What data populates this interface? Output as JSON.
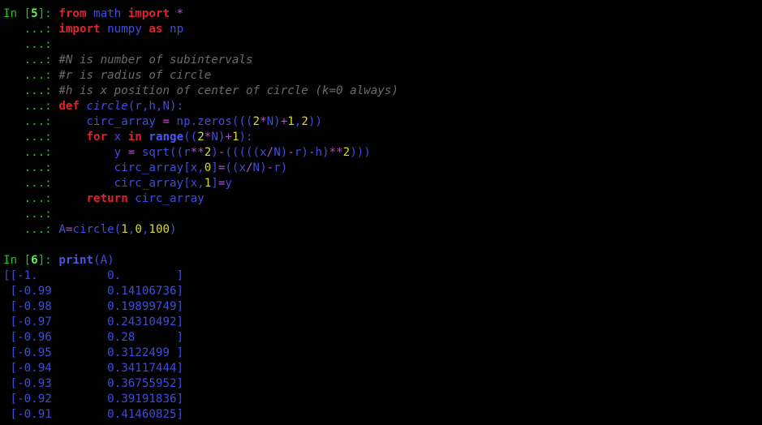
{
  "colors": {
    "background": "#000000",
    "prompt": "#22c322",
    "prompt_number": "#5cf05c",
    "keyword": "#e0222f",
    "name": "#3f4cdb",
    "number": "#d8d829",
    "operator": "#b24fd0",
    "comment": "#6a6a6a"
  },
  "lines": [
    [
      [
        "c-prompt",
        "In ["
      ],
      [
        "c-pnum",
        "5"
      ],
      [
        "c-prompt",
        "]: "
      ],
      [
        "c-kw",
        "from"
      ],
      [
        "c-name",
        " math "
      ],
      [
        "c-kw",
        "import"
      ],
      [
        "c-name",
        " "
      ],
      [
        "c-op",
        "*"
      ]
    ],
    [
      [
        "c-prompt",
        "   ...: "
      ],
      [
        "c-kw",
        "import"
      ],
      [
        "c-name",
        " numpy "
      ],
      [
        "c-kw",
        "as"
      ],
      [
        "c-name",
        " np"
      ]
    ],
    [
      [
        "c-prompt",
        "   ...: "
      ]
    ],
    [
      [
        "c-prompt",
        "   ...: "
      ],
      [
        "c-comment",
        "#N is number of subintervals"
      ]
    ],
    [
      [
        "c-prompt",
        "   ...: "
      ],
      [
        "c-comment",
        "#r is radius of circle"
      ]
    ],
    [
      [
        "c-prompt",
        "   ...: "
      ],
      [
        "c-comment",
        "#h is x position of center of circle (k=0 always)"
      ]
    ],
    [
      [
        "c-prompt",
        "   ...: "
      ],
      [
        "c-kw",
        "def"
      ],
      [
        "c-name",
        " "
      ],
      [
        "c-fn",
        "circle"
      ],
      [
        "c-name",
        "(r,h,N):"
      ]
    ],
    [
      [
        "c-prompt",
        "   ...: "
      ],
      [
        "c-name",
        "    circ_array "
      ],
      [
        "c-op",
        "="
      ],
      [
        "c-name",
        " np.zeros((("
      ],
      [
        "c-num",
        "2"
      ],
      [
        "c-op",
        "*"
      ],
      [
        "c-name",
        "N)"
      ],
      [
        "c-op",
        "+"
      ],
      [
        "c-num",
        "1"
      ],
      [
        "c-name",
        ","
      ],
      [
        "c-num",
        "2"
      ],
      [
        "c-name",
        "))"
      ]
    ],
    [
      [
        "c-prompt",
        "   ...: "
      ],
      [
        "c-name",
        "    "
      ],
      [
        "c-kw",
        "for"
      ],
      [
        "c-name",
        " x "
      ],
      [
        "c-kw",
        "in"
      ],
      [
        "c-name",
        " "
      ],
      [
        "c-builtin",
        "range"
      ],
      [
        "c-name",
        "(("
      ],
      [
        "c-num",
        "2"
      ],
      [
        "c-op",
        "*"
      ],
      [
        "c-name",
        "N)"
      ],
      [
        "c-op",
        "+"
      ],
      [
        "c-num",
        "1"
      ],
      [
        "c-name",
        "):"
      ]
    ],
    [
      [
        "c-prompt",
        "   ...: "
      ],
      [
        "c-name",
        "        y "
      ],
      [
        "c-op",
        "="
      ],
      [
        "c-name",
        " sqrt((r"
      ],
      [
        "c-op",
        "**"
      ],
      [
        "c-num",
        "2"
      ],
      [
        "c-name",
        ")"
      ],
      [
        "c-op",
        "-"
      ],
      [
        "c-name",
        "(((((x"
      ],
      [
        "c-op",
        "/"
      ],
      [
        "c-name",
        "N)"
      ],
      [
        "c-op",
        "-"
      ],
      [
        "c-name",
        "r)"
      ],
      [
        "c-op",
        "-"
      ],
      [
        "c-name",
        "h)"
      ],
      [
        "c-op",
        "**"
      ],
      [
        "c-num",
        "2"
      ],
      [
        "c-name",
        ")))"
      ]
    ],
    [
      [
        "c-prompt",
        "   ...: "
      ],
      [
        "c-name",
        "        circ_array[x,"
      ],
      [
        "c-num",
        "0"
      ],
      [
        "c-name",
        "]"
      ],
      [
        "c-op",
        "="
      ],
      [
        "c-name",
        "((x"
      ],
      [
        "c-op",
        "/"
      ],
      [
        "c-name",
        "N)"
      ],
      [
        "c-op",
        "-"
      ],
      [
        "c-name",
        "r)"
      ]
    ],
    [
      [
        "c-prompt",
        "   ...: "
      ],
      [
        "c-name",
        "        circ_array[x,"
      ],
      [
        "c-num",
        "1"
      ],
      [
        "c-name",
        "]"
      ],
      [
        "c-op",
        "="
      ],
      [
        "c-name",
        "y"
      ]
    ],
    [
      [
        "c-prompt",
        "   ...: "
      ],
      [
        "c-name",
        "    "
      ],
      [
        "c-kw",
        "return"
      ],
      [
        "c-name",
        " circ_array"
      ]
    ],
    [
      [
        "c-prompt",
        "   ...: "
      ]
    ],
    [
      [
        "c-prompt",
        "   ...: "
      ],
      [
        "c-name",
        "A"
      ],
      [
        "c-op",
        "="
      ],
      [
        "c-name",
        "circle("
      ],
      [
        "c-num",
        "1"
      ],
      [
        "c-name",
        ","
      ],
      [
        "c-num",
        "0"
      ],
      [
        "c-name",
        ","
      ],
      [
        "c-num",
        "100"
      ],
      [
        "c-name",
        ")"
      ]
    ],
    [],
    [
      [
        "c-prompt",
        "In ["
      ],
      [
        "c-pnum",
        "6"
      ],
      [
        "c-prompt",
        "]: "
      ],
      [
        "c-builtin",
        "print"
      ],
      [
        "c-name",
        "(A)"
      ]
    ],
    [
      [
        "c-out",
        "[[-1.          0.        ]"
      ]
    ],
    [
      [
        "c-out",
        " [-0.99        0.14106736]"
      ]
    ],
    [
      [
        "c-out",
        " [-0.98        0.19899749]"
      ]
    ],
    [
      [
        "c-out",
        " [-0.97        0.24310492]"
      ]
    ],
    [
      [
        "c-out",
        " [-0.96        0.28      ]"
      ]
    ],
    [
      [
        "c-out",
        " [-0.95        0.3122499 ]"
      ]
    ],
    [
      [
        "c-out",
        " [-0.94        0.34117444]"
      ]
    ],
    [
      [
        "c-out",
        " [-0.93        0.36755952]"
      ]
    ],
    [
      [
        "c-out",
        " [-0.92        0.39191836]"
      ]
    ],
    [
      [
        "c-out",
        " [-0.91        0.41460825]"
      ]
    ]
  ]
}
